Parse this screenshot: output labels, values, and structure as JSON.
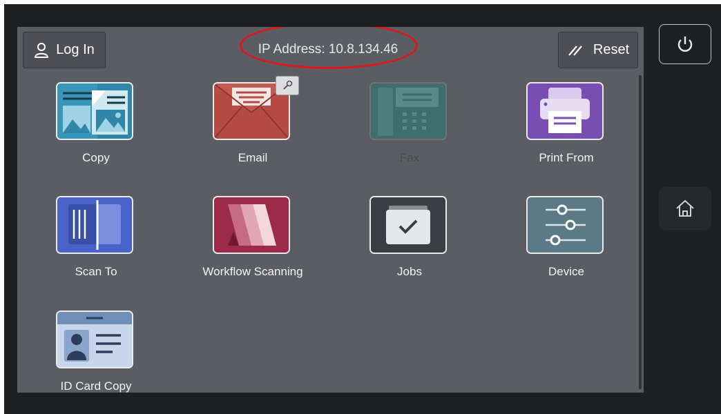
{
  "header": {
    "login_label": "Log In",
    "ip_address_text": "IP Address: 10.8.134.46",
    "reset_label": "Reset"
  },
  "apps": [
    {
      "label": "Copy",
      "icon": "copy-icon",
      "enabled": true
    },
    {
      "label": "Email",
      "icon": "email-icon",
      "enabled": true,
      "badge": "wrench-icon"
    },
    {
      "label": "Fax",
      "icon": "fax-icon",
      "enabled": false
    },
    {
      "label": "Print From",
      "icon": "print-icon",
      "enabled": true
    },
    {
      "label": "Scan To",
      "icon": "scan-icon",
      "enabled": true
    },
    {
      "label": "Workflow Scanning",
      "icon": "workflow-icon",
      "enabled": true
    },
    {
      "label": "Jobs",
      "icon": "jobs-icon",
      "enabled": true
    },
    {
      "label": "Device",
      "icon": "device-icon",
      "enabled": true
    },
    {
      "label": "ID Card Copy",
      "icon": "id-card-icon",
      "enabled": true
    }
  ],
  "side_buttons": {
    "power": "power-icon",
    "home": "home-icon"
  },
  "colors": {
    "screen_bg": "#5b5d62",
    "bezel": "#1f2022",
    "highlight_circle": "#e0161d",
    "copy_tile": "#2f86a8",
    "email_tile": "#b64a44",
    "fax_tile": "#3f6e6e",
    "print_tile": "#7a4db3",
    "scan_tile": "#4a63c9",
    "workflow_tile": "#9c2a4a",
    "jobs_tile": "#3b3d42",
    "device_tile": "#5c7a86",
    "id_card_tile": "#6f8fb8"
  }
}
